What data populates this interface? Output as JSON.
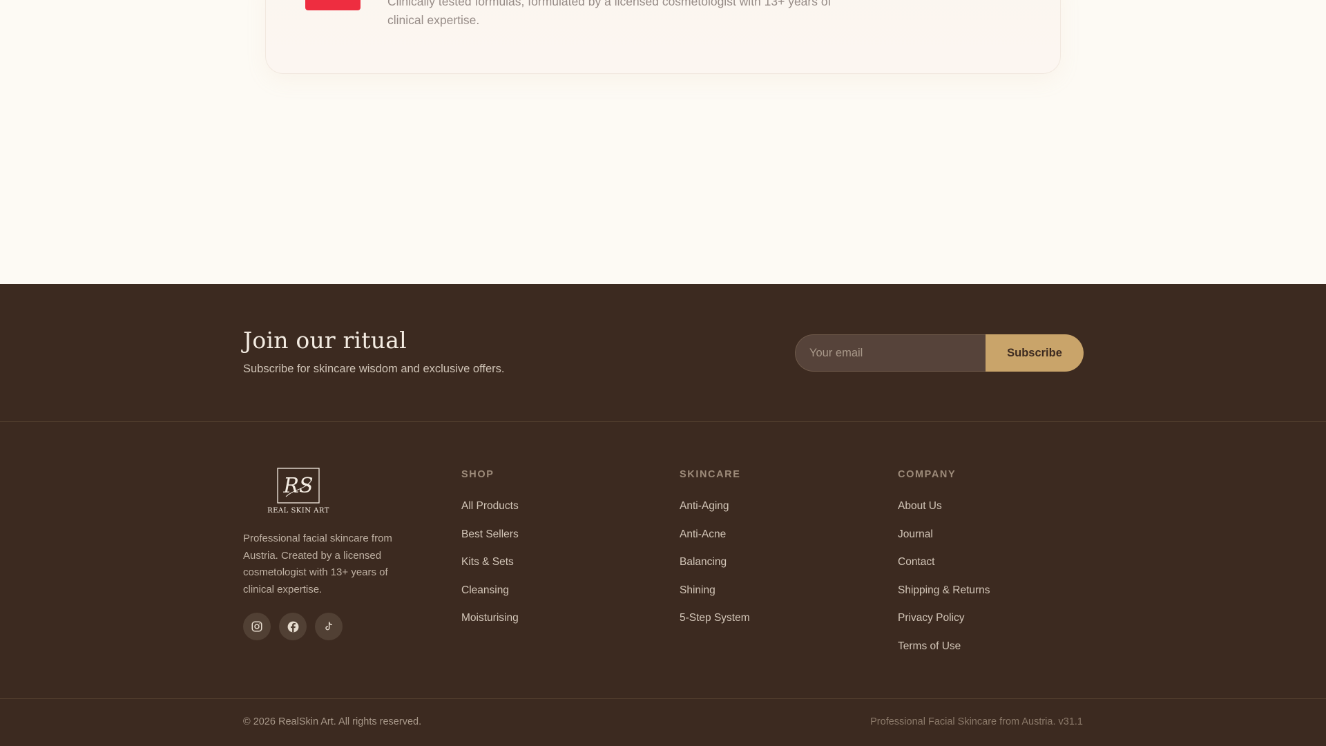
{
  "feature": {
    "text": "Clinically tested formulas, formulated by a licensed cosmetologist with 13+ years of clinical expertise."
  },
  "newsletter": {
    "title": "Join our ritual",
    "subtitle": "Subscribe for skincare wisdom and exclusive offers.",
    "email_placeholder": "Your email",
    "subscribe_label": "Subscribe"
  },
  "brand": {
    "logo_monogram": "RS",
    "logo_text": "REAL SKIN ART",
    "description": "Professional facial skincare from Austria. Created by a licensed cosmetologist with 13+ years of clinical expertise.",
    "socials": [
      {
        "icon": "instagram-icon"
      },
      {
        "icon": "facebook-icon"
      },
      {
        "icon": "tiktok-icon"
      }
    ]
  },
  "columns": {
    "shop": {
      "heading": "SHOP",
      "links": [
        "All Products",
        "Best Sellers",
        "Kits & Sets",
        "Cleansing",
        "Moisturising"
      ]
    },
    "skincare": {
      "heading": "SKINCARE",
      "links": [
        "Anti-Aging",
        "Anti-Acne",
        "Balancing",
        "Shining",
        "5-Step System"
      ]
    },
    "company": {
      "heading": "COMPANY",
      "links": [
        "About Us",
        "Journal",
        "Contact",
        "Shipping & Returns",
        "Privacy Policy",
        "Terms of Use"
      ]
    }
  },
  "bottom": {
    "copyright": "© 2026 RealSkin Art. All rights reserved.",
    "tagline": "Professional Facial Skincare from Austria. v31.1"
  },
  "colors": {
    "page_bg": "#fdfaf4",
    "footer_bg": "#3c2a20",
    "accent_gold": "#c9a46a",
    "badge_red": "#ee2d40"
  }
}
